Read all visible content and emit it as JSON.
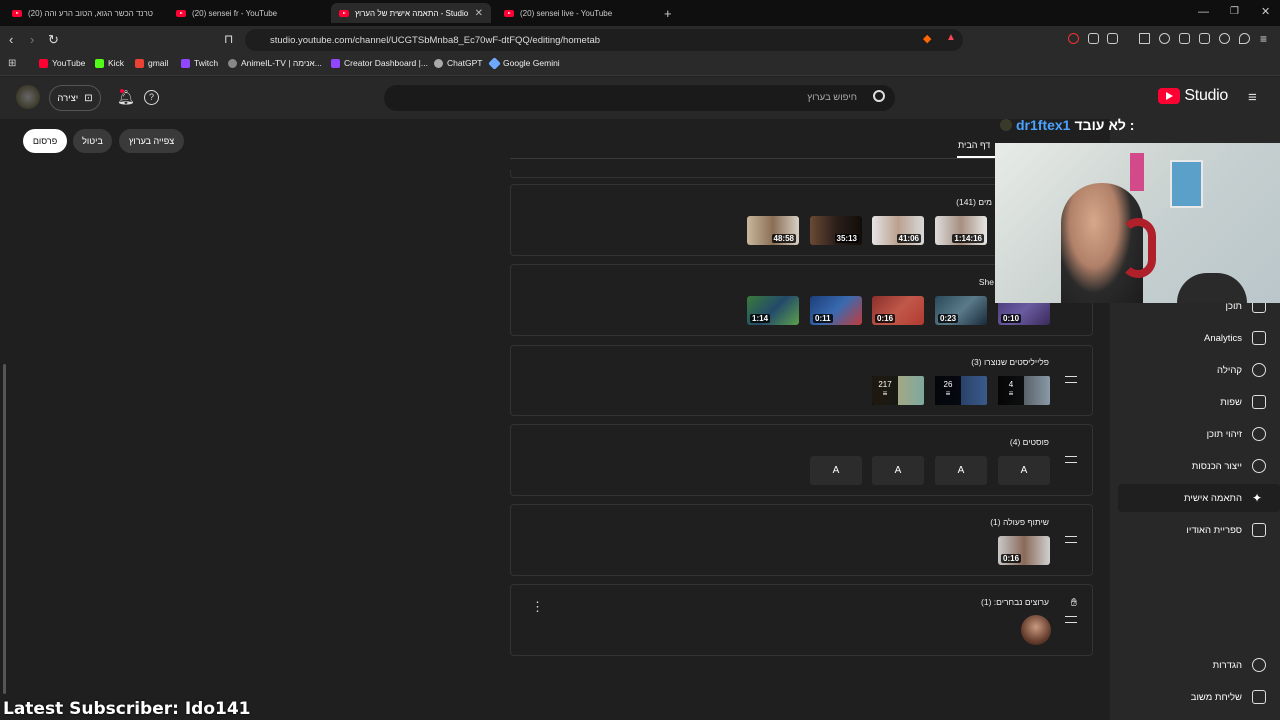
{
  "browser": {
    "tabs": [
      {
        "title": "טרנד הכשר הגוא, הטוב הרע והה (20)"
      },
      {
        "title": "(20) sensei fr - YouTube"
      },
      {
        "title": "התאמה אישית של הערוץ - Studio"
      },
      {
        "title": "(20) sensei live - YouTube"
      }
    ],
    "url": "studio.youtube.com/channel/UCGTSbMnba8_Ec70wF-dtFQQ/editing/hometab",
    "bookmarks": [
      "YouTube",
      "Kick",
      "gmail",
      "Twitch",
      "AnimeIL-TV | אנימה...",
      "Creator Dashboard |...",
      "ChatGPT",
      "Google Gemini"
    ]
  },
  "header": {
    "logo_text": "Studio",
    "search_placeholder": "חיפוש בערוץ",
    "create_label": "יצירה"
  },
  "actions": {
    "publish": "פרסום",
    "cancel": "ביטול",
    "view_channel": "צפייה בערוץ"
  },
  "page_tab": "דף הבית",
  "sections": {
    "videos_title": "מים (141)",
    "video_durations": [
      "48:58",
      "35:13",
      "41:06",
      "1:14:16"
    ],
    "shorts_title": "She",
    "short_durations": [
      "1:14",
      "0:11",
      "0:16",
      "0:23",
      "0:10"
    ],
    "playlists_title": "פלייליסטים שנוצרו (3)",
    "playlist_counts": [
      "217",
      "26",
      "4"
    ],
    "posts_title": "פוסטים (4)",
    "post_letters": [
      "A",
      "A",
      "A",
      "A"
    ],
    "collab_title": "שיתוף פעולה (1)",
    "collab_duration": "0:16",
    "featured_title": "ערוצים נבחרים: (1)"
  },
  "sidebar": {
    "items": [
      {
        "label": "תוכן"
      },
      {
        "label": "Analytics"
      },
      {
        "label": "קהילה"
      },
      {
        "label": "שפות"
      },
      {
        "label": "זיהוי תוכן"
      },
      {
        "label": "ייצור הכנסות"
      },
      {
        "label": "התאמה אישית"
      },
      {
        "label": "ספריית האודיו"
      },
      {
        "label": "הגדרות"
      },
      {
        "label": "שליחת משוב"
      }
    ]
  },
  "stream_overlay": {
    "status_prefix": "לא עובד :",
    "handle": "dr1ftex1",
    "latest_subscriber": "Latest Subscriber: Ido141"
  },
  "colors": {
    "accent_red": "#ff0033",
    "handle_blue": "#4aa3ff",
    "background": "#1f1f1f"
  }
}
